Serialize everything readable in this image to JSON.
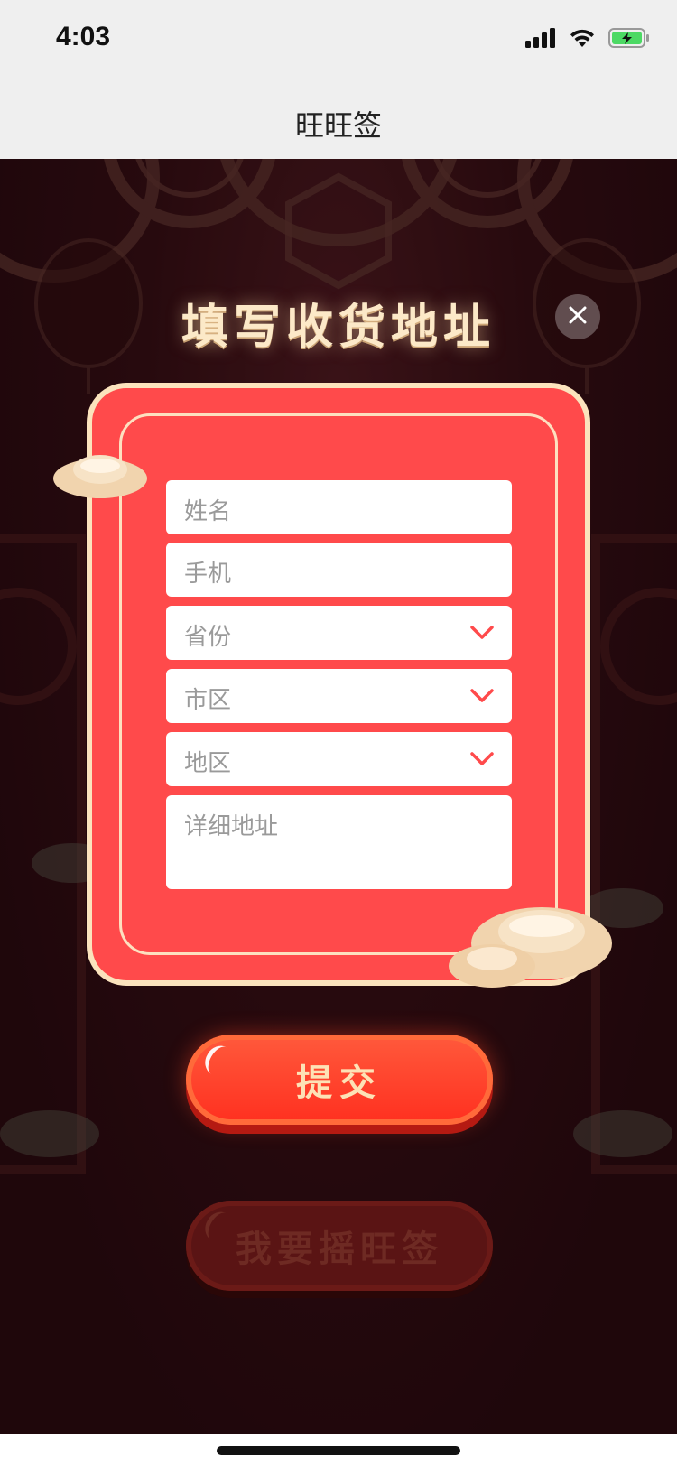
{
  "status_bar": {
    "time": "4:03"
  },
  "nav": {
    "title": "旺旺签"
  },
  "modal": {
    "title": "填写收货地址",
    "close_label": "×"
  },
  "form": {
    "name_placeholder": "姓名",
    "phone_placeholder": "手机",
    "province_placeholder": "省份",
    "city_placeholder": "市区",
    "district_placeholder": "地区",
    "address_placeholder": "详细地址"
  },
  "buttons": {
    "submit_label": "提交",
    "shake_label": "我要摇旺签"
  },
  "colors": {
    "card_red": "#ff4a4b",
    "card_border": "#fbe3bd",
    "submit_red": "#ff2f1f",
    "title_cream": "#fce9c8"
  }
}
